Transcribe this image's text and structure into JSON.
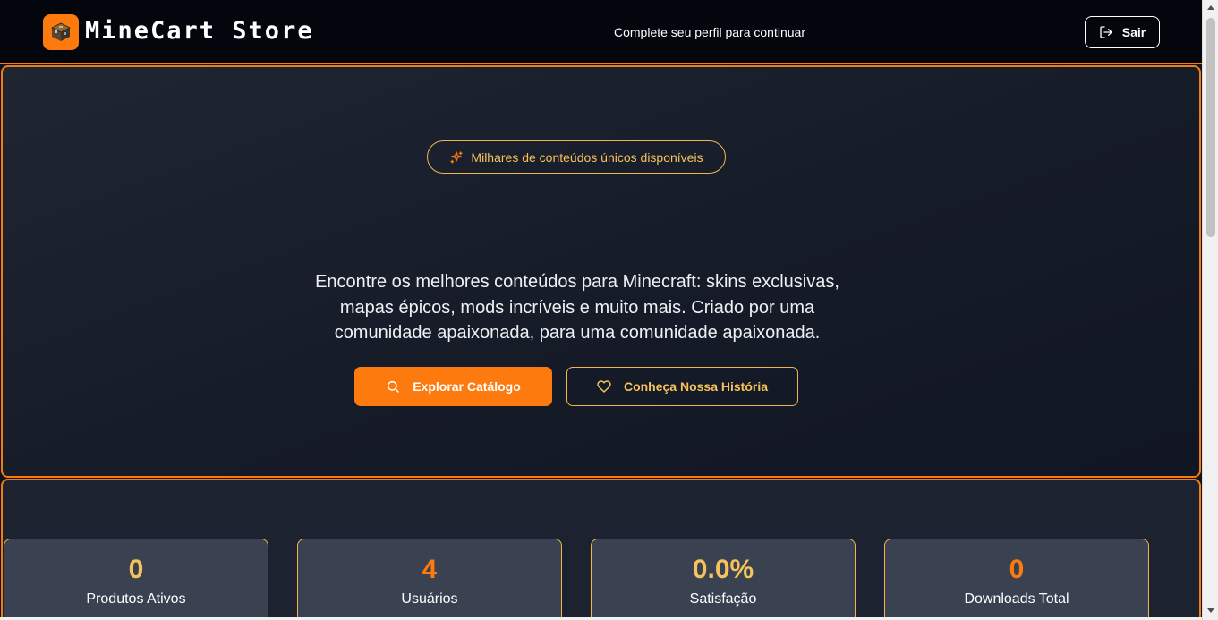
{
  "header": {
    "brand": "MineCart Store",
    "message": "Complete seu perfil para continuar",
    "logout_label": "Sair",
    "logo_icon": "minecraft-block-icon",
    "logout_icon": "logout-icon"
  },
  "hero": {
    "badge_text": "Milhares de conteúdos únicos disponíveis",
    "badge_icon": "sparkles-icon",
    "tagline": "Encontre os melhores conteúdos para Minecraft: skins exclusivas, mapas épicos, mods incríveis e muito mais. Criado por uma comunidade apaixonada, para uma comunidade apaixonada.",
    "primary_button": "Explorar Catálogo",
    "primary_icon": "search-icon",
    "secondary_button": "Conheça Nossa História",
    "secondary_icon": "heart-icon"
  },
  "stats": [
    {
      "value": "0",
      "label": "Produtos Ativos",
      "color": "#f6c25b"
    },
    {
      "value": "4",
      "label": "Usuários",
      "color": "#fd7a0f"
    },
    {
      "value": "0.0%",
      "label": "Satisfação",
      "color": "#f6c25b"
    },
    {
      "value": "0",
      "label": "Downloads Total",
      "color": "#fd7a0f"
    }
  ],
  "colors": {
    "accent_orange": "#fd7a0f",
    "accent_yellow": "#f6c25b",
    "header_bg": "#03060d",
    "card_bg": "#3a4252"
  }
}
